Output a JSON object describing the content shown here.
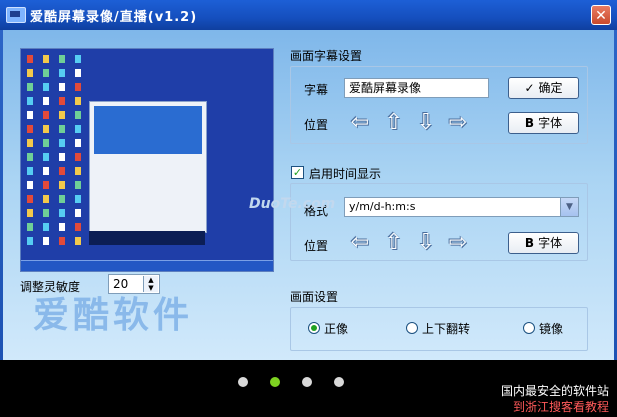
{
  "window": {
    "title": "爱酷屏幕录像/直播(v1.2)",
    "close_label": "✕"
  },
  "left": {
    "sensitivity_label": "调整灵敏度",
    "sensitivity_value": "20",
    "brand_watermark": "爱酷软件"
  },
  "caption_settings": {
    "title": "画面字幕设置",
    "caption_label": "字幕",
    "caption_value": "爱酷屏幕录像",
    "confirm_label": "确定",
    "position_label": "位置",
    "font_label": "字体"
  },
  "time_settings": {
    "enable_label": "启用时间显示",
    "enabled": true,
    "format_label": "格式",
    "format_value": "y/m/d-h:m:s",
    "position_label": "位置",
    "font_label": "字体"
  },
  "picture_settings": {
    "title": "画面设置",
    "options": [
      "正像",
      "上下翻转",
      "镜像"
    ],
    "selected": 0
  },
  "watermark": "DuoTe.com",
  "pager": {
    "count": 4,
    "active": 1
  },
  "footer": {
    "line1": "国内最安全的软件站",
    "line2": "到浙江搜客看教程"
  }
}
